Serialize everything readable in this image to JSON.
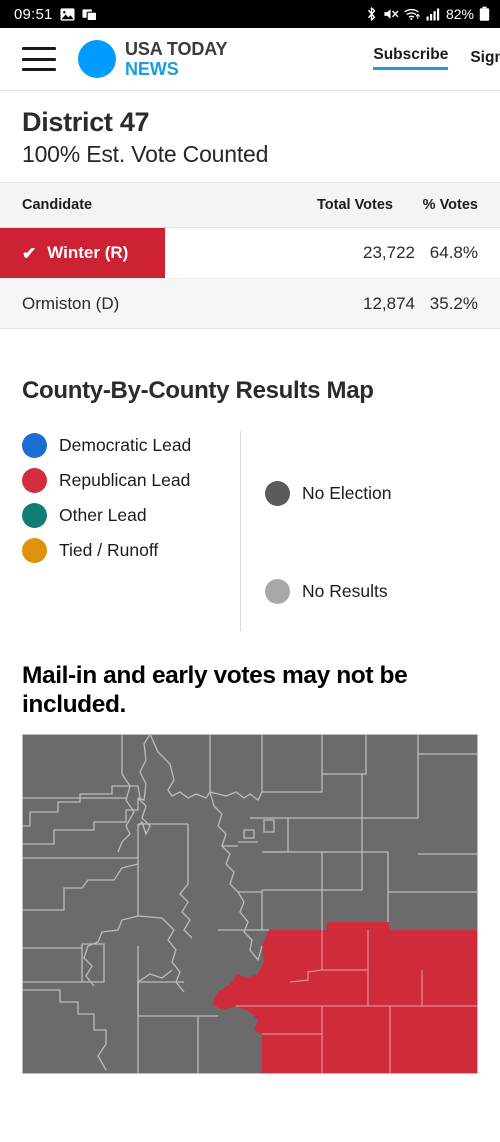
{
  "status_bar": {
    "clock": "09:51",
    "battery_percent": "82%",
    "icons": [
      "image-icon",
      "multi-window-icon",
      "bluetooth-icon",
      "volume-mute-icon",
      "wifi-icon",
      "cellular-signal-icon",
      "battery-icon"
    ]
  },
  "header": {
    "menu_icon": "hamburger-menu-icon",
    "brand_line1": "USA TODAY",
    "brand_line2": "NEWS",
    "subscribe_label": "Subscribe",
    "signin_label": "Sign In",
    "accent_blue": "#009bff"
  },
  "race": {
    "title": "District 47",
    "subtitle": "100% Est. Vote Counted"
  },
  "results_table": {
    "columns": [
      "Candidate",
      "Total Votes",
      "% Votes"
    ],
    "rows": [
      {
        "candidate": "Winter (R)",
        "total_votes": "23,722",
        "pct_votes": "64.8%",
        "winner": true,
        "check_glyph": "✔"
      },
      {
        "candidate": "Ormiston (D)",
        "total_votes": "12,874",
        "pct_votes": "35.2%",
        "winner": false,
        "check_glyph": ""
      }
    ],
    "winner_color": "#cc2233"
  },
  "map_section": {
    "heading": "County-By-County Results Map",
    "legend_left": [
      {
        "label": "Democratic Lead",
        "color": "#1b6ed0"
      },
      {
        "label": "Republican Lead",
        "color": "#d32d3f"
      },
      {
        "label": "Other Lead",
        "color": "#117d74"
      },
      {
        "label": "Tied / Runoff",
        "color": "#e0920c"
      }
    ],
    "legend_right": [
      {
        "label": "No Election",
        "color": "#5a5a5a"
      },
      {
        "label": "No Results",
        "color": "#a8a8a8"
      }
    ],
    "notice": "Mail-in and early votes may not be included.",
    "map": {
      "state": "Colorado",
      "no_election_color": "#6b6b6b",
      "republican_lead_color": "#cf2b3a",
      "border_color": "#bcbcbc"
    }
  }
}
